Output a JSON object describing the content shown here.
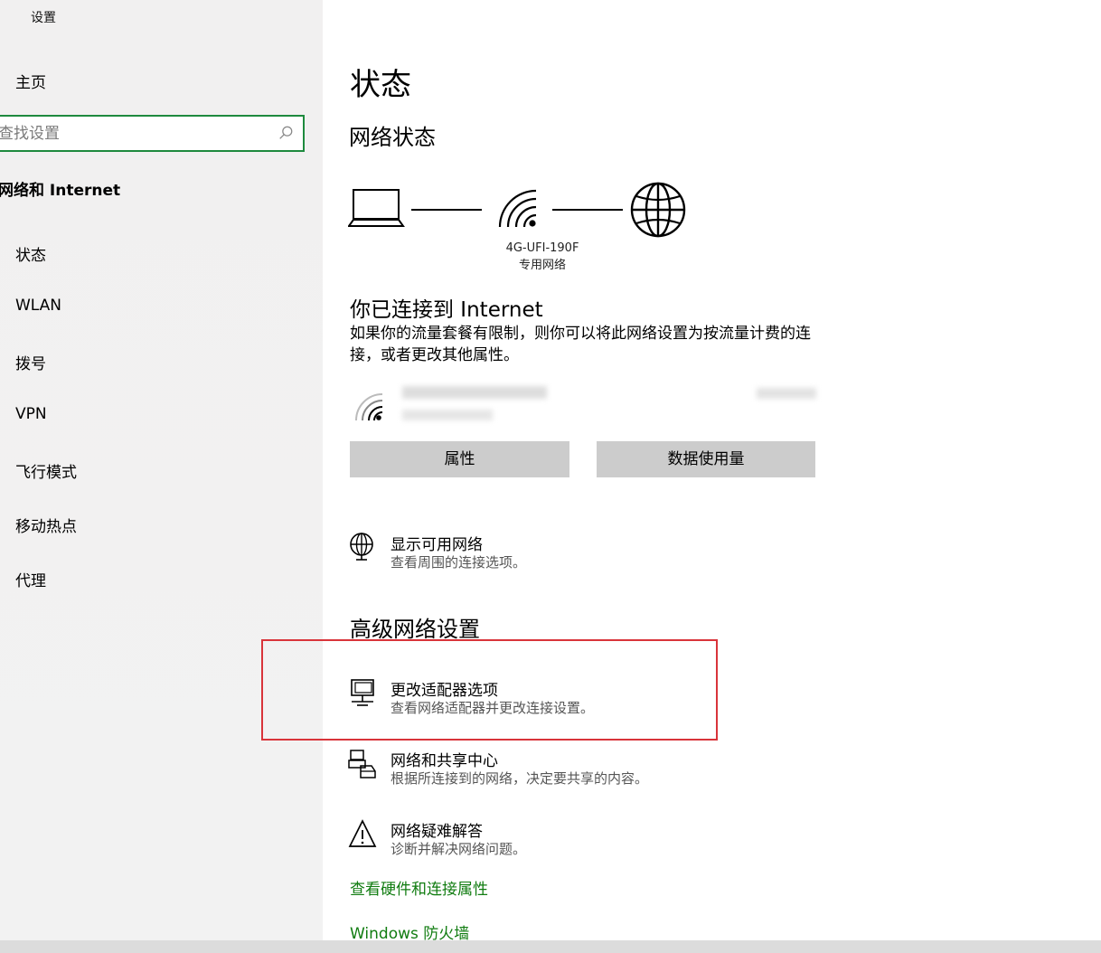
{
  "window": {
    "title": "设置"
  },
  "sidebar": {
    "home_label": "主页",
    "search_placeholder": "查找设置",
    "section_title": "网络和 Internet",
    "items": [
      {
        "label": "状态"
      },
      {
        "label": "WLAN"
      },
      {
        "label": "拨号"
      },
      {
        "label": "VPN"
      },
      {
        "label": "飞行模式"
      },
      {
        "label": "移动热点"
      },
      {
        "label": "代理"
      }
    ]
  },
  "main": {
    "page_title": "状态",
    "network_status_title": "网络状态",
    "network": {
      "name": "4G-UFI-190F",
      "type": "专用网络"
    },
    "connected_title": "你已连接到 Internet",
    "connected_desc": "如果你的流量套餐有限制，则你可以将此网络设置为按流量计费的连接，或者更改其他属性。",
    "properties_button": "属性",
    "data_usage_button": "数据使用量",
    "show_networks": {
      "title": "显示可用网络",
      "desc": "查看周围的连接选项。"
    },
    "advanced_title": "高级网络设置",
    "advanced_items": [
      {
        "title": "更改适配器选项",
        "desc": "查看网络适配器并更改连接设置。"
      },
      {
        "title": "网络和共享中心",
        "desc": "根据所连接到的网络，决定要共享的内容。"
      },
      {
        "title": "网络疑难解答",
        "desc": "诊断并解决网络问题。"
      }
    ],
    "hardware_link": "查看硬件和连接属性",
    "firewall_link": "Windows 防火墙"
  },
  "colors": {
    "accent": "#107c10",
    "search_border": "#1e8a3e",
    "highlight": "#d9343a",
    "button_bg": "#cccccc"
  }
}
